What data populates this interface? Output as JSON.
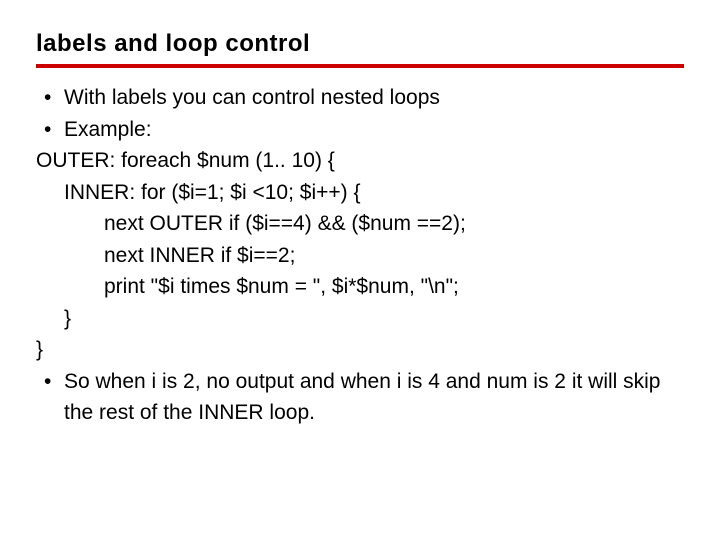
{
  "title": "labels and loop control",
  "bullet1": "With labels you can control nested loops",
  "bullet2": "Example:",
  "code": {
    "l1": "OUTER: foreach $num (1.. 10) {",
    "l2": "INNER: for ($i=1; $i <10; $i++) {",
    "l3": "next OUTER if ($i==4) && ($num ==2);",
    "l4": "next INNER if $i==2;",
    "l5": "print \"$i times $num = \", $i*$num, \"\\n\";",
    "l6": "}",
    "l7": "}"
  },
  "bullet3": "So when i is 2, no output and when i is 4 and num is 2 it will skip the rest of the INNER loop."
}
